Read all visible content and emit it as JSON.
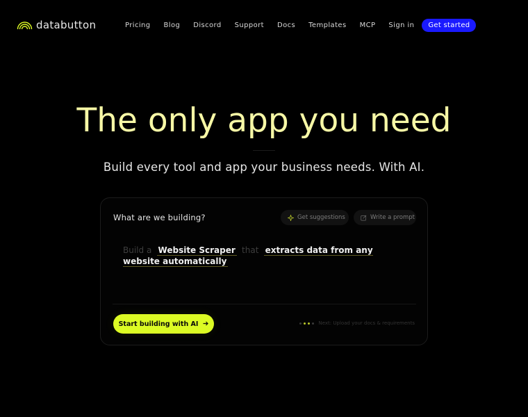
{
  "brand": {
    "name": "databutton",
    "accent_color": "#dcfb24",
    "logo_icon": "rainbow-arc-icon"
  },
  "nav": {
    "links": [
      "Pricing",
      "Blog",
      "Discord",
      "Support",
      "Docs",
      "Templates",
      "MCP",
      "Sign in"
    ],
    "cta_label": "Get started",
    "cta_color": "#1a1aff"
  },
  "hero": {
    "title_accent": "The only app you",
    "title_rest": "need",
    "subtitle": "Build every tool and app your business needs. With AI."
  },
  "card": {
    "question": "What are we building?",
    "suggest_label": "Get suggestions",
    "suggest_icon": "sparkle-icon",
    "write_label": "Write a prompt",
    "write_icon": "edit-icon",
    "prompt": {
      "prefix": "Build a",
      "subject": "Website Scraper",
      "connector": "that",
      "action": "extracts data from any website automatically"
    },
    "start_label": "Start building with AI",
    "start_icon": "arrow-right-icon",
    "next_hint": "Next: Upload your docs & requirements"
  }
}
